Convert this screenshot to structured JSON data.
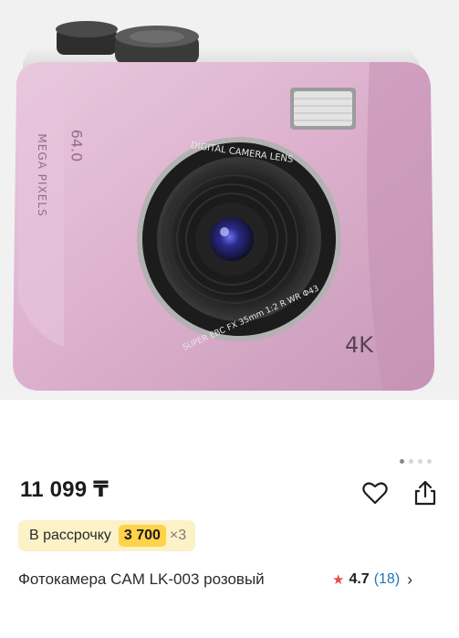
{
  "product": {
    "image_alt": "Фотокамера CAM LK-003 розовый",
    "camera_lettering": {
      "megapixels": "64.0",
      "mega_pixels_label": "MEGA PIXELS",
      "lens_top": "DIGITAL CAMERA LENS",
      "lens_bottom": "SUPER EBC FX 35mm 1:2 R WR Φ43",
      "resolution_badge": "4K"
    },
    "gallery": {
      "total_dots": 4,
      "active_index": 0
    },
    "price": "11 099 ₸",
    "installment": {
      "label": "В рассрочку",
      "amount": "3 700",
      "multiplier": "×3"
    },
    "title": "Фотокамера CAM LK-003 розовый",
    "rating": {
      "score": "4.7",
      "count": "(18)"
    }
  },
  "icons": {
    "favorite": "heart-outline-icon",
    "share": "share-icon",
    "rating_star": "star-icon",
    "chevron": "chevron-right-icon"
  },
  "colors": {
    "installment_bg": "#fcf1c7",
    "installment_amount_bg": "#ffd24a",
    "rating_star": "#e54e42",
    "rating_count": "#1f75b8",
    "camera_body": "#dbb1cf"
  }
}
